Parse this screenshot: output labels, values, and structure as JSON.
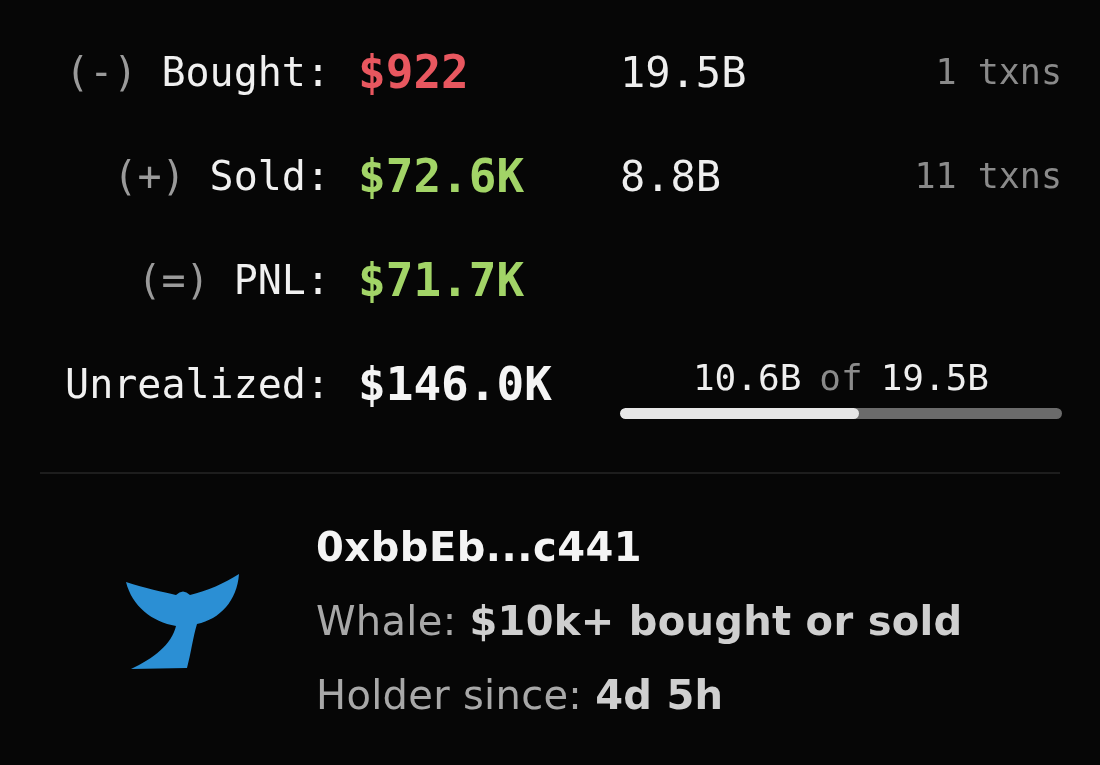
{
  "rows": [
    {
      "sign": "(-)",
      "label": "Bought:",
      "value": "$922",
      "color": "#e8575f",
      "amount": "19.5B",
      "txns": "1 txns"
    },
    {
      "sign": "(+)",
      "label": "Sold:",
      "value": "$72.6K",
      "color": "#a2d467",
      "amount": "8.8B",
      "txns": "11 txns"
    },
    {
      "sign": "(=)",
      "label": "PNL:",
      "value": "$71.7K",
      "color": "#a2d467"
    }
  ],
  "unrealized": {
    "label": "Unrealized:",
    "value": "$146.0K",
    "held": "10.6B",
    "of": "of",
    "total": "19.5B",
    "level": 0.54
  },
  "wallet": {
    "address": "0xbbEb...c441",
    "lines": [
      "Whale: **$10k+ bought or sold**",
      "Holder since: **4d 5h**"
    ]
  }
}
